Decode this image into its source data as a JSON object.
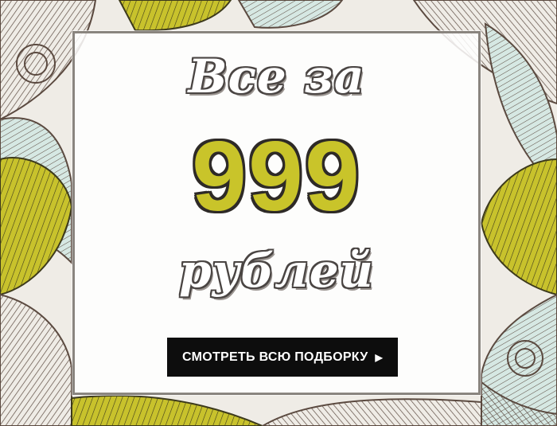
{
  "banner": {
    "headline_top": "Все за",
    "price": "999",
    "headline_bottom": "рублей",
    "cta_label": "СМОТРЕТЬ ВСЮ ПОДБОРКУ",
    "cta_icon": "play-triangle-icon",
    "cta_glyph": "▶"
  },
  "colors": {
    "price_fill": "#c9c42a",
    "price_outline": "#2e2a27",
    "cta_background": "#0d0d0d",
    "cta_text": "#ffffff",
    "card_border": "#8a857f",
    "doodle_brown": "#5b4a40",
    "doodle_yellow": "#c8c22c",
    "doodle_mint": "#bcd9d3"
  }
}
